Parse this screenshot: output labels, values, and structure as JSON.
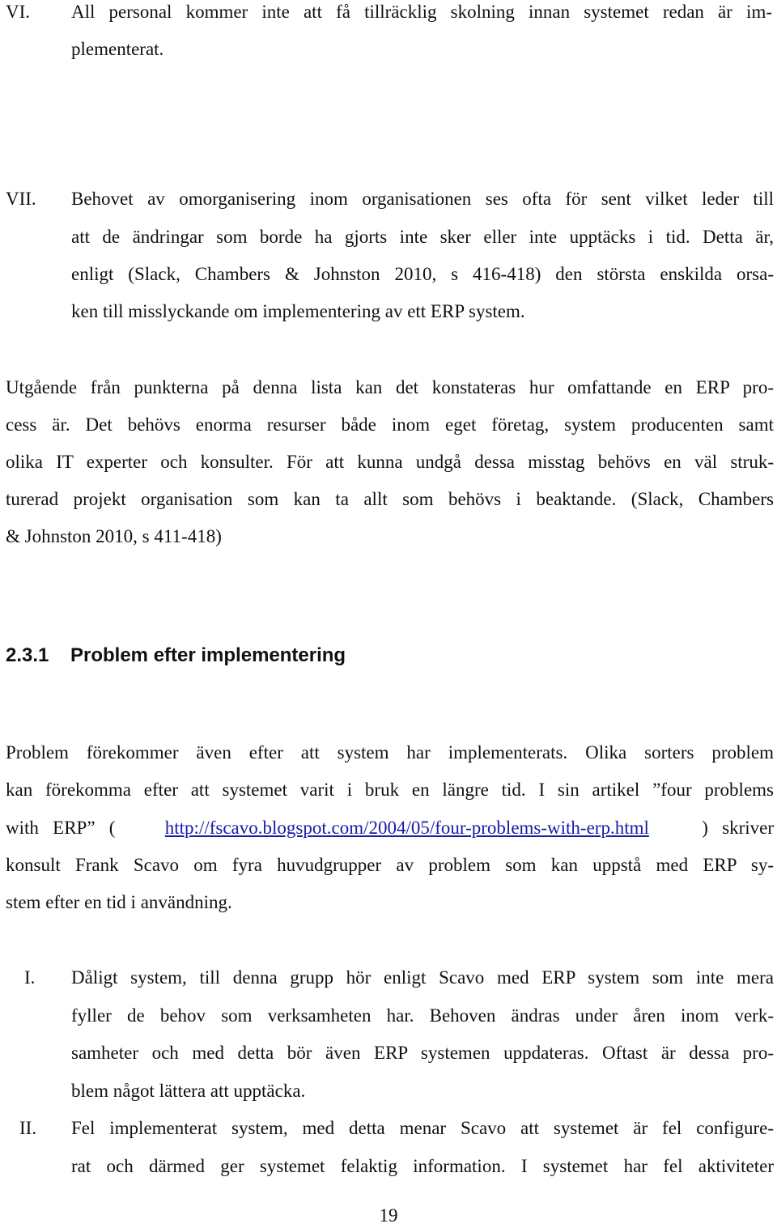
{
  "list_top": [
    {
      "numeral": "VI.",
      "lines": [
        "All personal kommer inte att få tillräcklig skolning innan systemet redan är im-",
        "plementerat."
      ]
    },
    {
      "numeral": "VII.",
      "lines": [
        "Behovet av omorganisering inom organisationen ses ofta för sent vilket leder till",
        "att de ändringar som borde ha gjorts inte sker eller inte upptäcks i tid. Detta är,",
        "enligt (Slack, Chambers & Johnston 2010, s 416-418) den största enskilda orsa-",
        "ken till misslyckande om implementering av ett ERP system."
      ]
    }
  ],
  "paragraph1": {
    "lines": [
      "Utgående från punkterna på denna lista kan det konstateras hur omfattande en ERP pro-",
      "cess är. Det behövs enorma resurser både inom eget företag, system producenten samt",
      "olika IT experter och konsulter. För att kunna undgå dessa misstag behövs en väl struk-",
      "turerad projekt organisation som kan ta allt som behövs i beaktande. (Slack, Chambers",
      "& Johnston 2010, s 411-418)"
    ]
  },
  "section": {
    "number": "2.3.1",
    "title": "Problem efter implementering"
  },
  "paragraph2": {
    "line1": "Problem förekommer även efter att system har implementerats. Olika sorters problem",
    "line2": "kan förekomma efter att systemet varit i bruk en längre tid. I sin artikel ”four problems",
    "line3_pre": "with   ERP”   (",
    "link": "http://fscavo.blogspot.com/2004/05/four-problems-with-erp.html",
    "line3_post": ")   skriver",
    "line4": "konsult Frank Scavo om fyra huvudgrupper av problem som kan uppstå med ERP sy-",
    "line5": "stem efter en tid i användning."
  },
  "list_bottom": [
    {
      "numeral": "I.",
      "lines": [
        "Dåligt system, till denna grupp hör enligt Scavo med ERP system som inte mera",
        "fyller de behov som verksamheten har. Behoven ändras under åren inom verk-",
        "samheter och med detta bör även ERP systemen uppdateras. Oftast är dessa pro-",
        "blem något lättera att upptäcka."
      ]
    },
    {
      "numeral": "II.",
      "lines": [
        "Fel implementerat system, med detta menar Scavo att systemet är fel configure-",
        "rat och därmed ger systemet felaktig information. I systemet har fel aktiviteter"
      ]
    }
  ],
  "page_number": "19",
  "colors": {
    "link": "#1a1aa6",
    "text": "#111111"
  }
}
